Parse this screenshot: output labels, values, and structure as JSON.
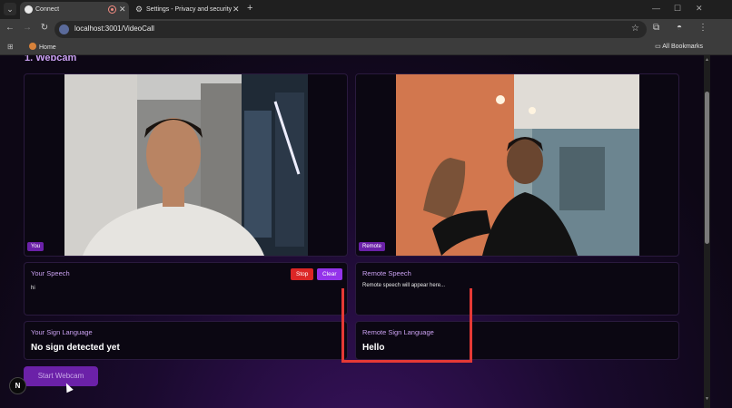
{
  "browser": {
    "tabs": [
      {
        "title": "Connect",
        "active": true
      },
      {
        "title": "Settings - Privacy and security",
        "active": false
      }
    ],
    "url": "localhost:3001/VideoCall",
    "bookmarks": {
      "home": "Home",
      "all": "All Bookmarks"
    }
  },
  "page": {
    "heading": "1. Webcam",
    "local_video": {
      "badge": "You"
    },
    "remote_video": {
      "badge": "Remote"
    },
    "your_speech": {
      "title": "Your Speech",
      "text": "hi",
      "stop_label": "Stop",
      "clear_label": "Clear"
    },
    "remote_speech": {
      "title": "Remote Speech",
      "text": "Remote speech will appear here..."
    },
    "your_sign": {
      "title": "Your Sign Language",
      "value": "No sign detected yet"
    },
    "remote_sign": {
      "title": "Remote Sign Language",
      "value": "Hello"
    },
    "start_button": "Start Webcam",
    "dev_badge": "N"
  },
  "colors": {
    "accent": "#9333ea",
    "stop": "#dc2626",
    "highlight": "#e53935",
    "title": "#c9a0f0"
  }
}
